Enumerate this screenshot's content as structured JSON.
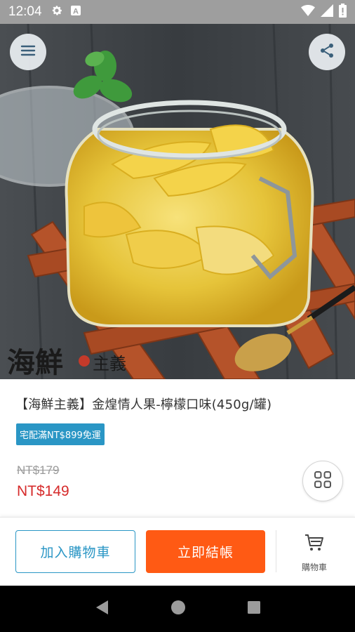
{
  "status_bar": {
    "time": "12:04",
    "icons": [
      "settings-icon",
      "a-badge-icon",
      "wifi-icon",
      "signal-icon",
      "battery-icon"
    ]
  },
  "hero": {
    "image": "pickled-mango-jar-photo",
    "watermark_text": "海鮮主義",
    "menu_icon": "hamburger-menu-icon",
    "share_icon": "share-icon"
  },
  "product": {
    "title": "【海鮮主義】金煌情人果-檸檬口味(450g/罐)",
    "badge": "宅配滿NT$899免運",
    "original_price": "NT$179",
    "sale_price": "NT$149"
  },
  "actions": {
    "add_to_cart": "加入購物車",
    "checkout": "立即結帳",
    "cart_label": "購物車"
  },
  "colors": {
    "accent_blue": "#2a96c5",
    "checkout_orange": "#ff5a14",
    "price_red": "#d62b2b"
  }
}
